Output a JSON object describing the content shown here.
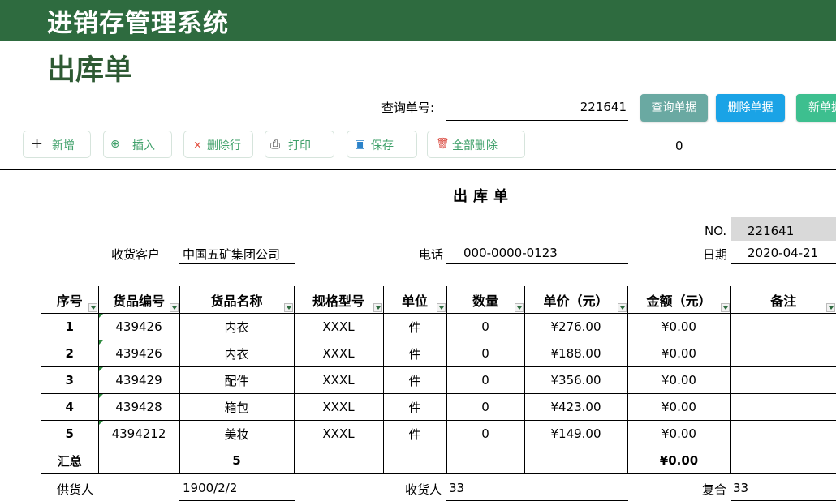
{
  "app": {
    "title": "进销存管理系统",
    "heading": "出库单"
  },
  "query": {
    "label": "查询单号:",
    "value": "221641"
  },
  "top_buttons": {
    "query": "查询单据",
    "delete_doc": "删除单据",
    "new_doc": "新单据"
  },
  "toolbar": {
    "add": {
      "icon": "+",
      "label": "新增"
    },
    "insert": {
      "icon": "⊕",
      "label": "插入"
    },
    "delete_row": {
      "icon": "×",
      "label": "删除行"
    },
    "print": {
      "icon": "⎙",
      "label": "打印"
    },
    "save": {
      "icon": "▣",
      "label": "保存"
    },
    "delete_all": {
      "icon": "🗑",
      "label": "全部删除"
    },
    "counter": "0"
  },
  "form": {
    "title": "出库单",
    "no_label": "NO.",
    "no_value": "221641",
    "customer_label": "收货客户",
    "customer_value": "中国五矿集团公司",
    "phone_label": "电话",
    "phone_value": "000-0000-0123",
    "date_label": "日期",
    "date_value": "2020-04-21"
  },
  "table": {
    "headers": [
      "序号",
      "货品编号",
      "货品名称",
      "规格型号",
      "单位",
      "数量",
      "单价（元）",
      "金额（元）",
      "备注"
    ],
    "rows": [
      [
        "1",
        "439426",
        "内衣",
        "XXXL",
        "件",
        "0",
        "¥276.00",
        "¥0.00",
        ""
      ],
      [
        "2",
        "439426",
        "内衣",
        "XXXL",
        "件",
        "0",
        "¥188.00",
        "¥0.00",
        ""
      ],
      [
        "3",
        "439429",
        "配件",
        "XXXL",
        "件",
        "0",
        "¥356.00",
        "¥0.00",
        ""
      ],
      [
        "4",
        "439428",
        "箱包",
        "XXXL",
        "件",
        "0",
        "¥423.00",
        "¥0.00",
        ""
      ],
      [
        "5",
        "4394212",
        "美妆",
        "XXXL",
        "件",
        "0",
        "¥149.00",
        "¥0.00",
        ""
      ]
    ],
    "summary": [
      "汇总",
      "",
      "5",
      "",
      "",
      "",
      "",
      "¥0.00",
      ""
    ]
  },
  "footer": {
    "supplier_label": "供货人",
    "supplier_value": "1900/2/2",
    "receiver_label": "收货人",
    "receiver_value": "33",
    "reviewer_label": "复合",
    "reviewer_value": "33"
  },
  "colors": {
    "header_bg": "#2e6b3f",
    "heading": "#2e5a33",
    "query_btn": "#6aa9a2",
    "delete_btn": "#1aa3e6",
    "new_btn": "#3dbf8f"
  }
}
